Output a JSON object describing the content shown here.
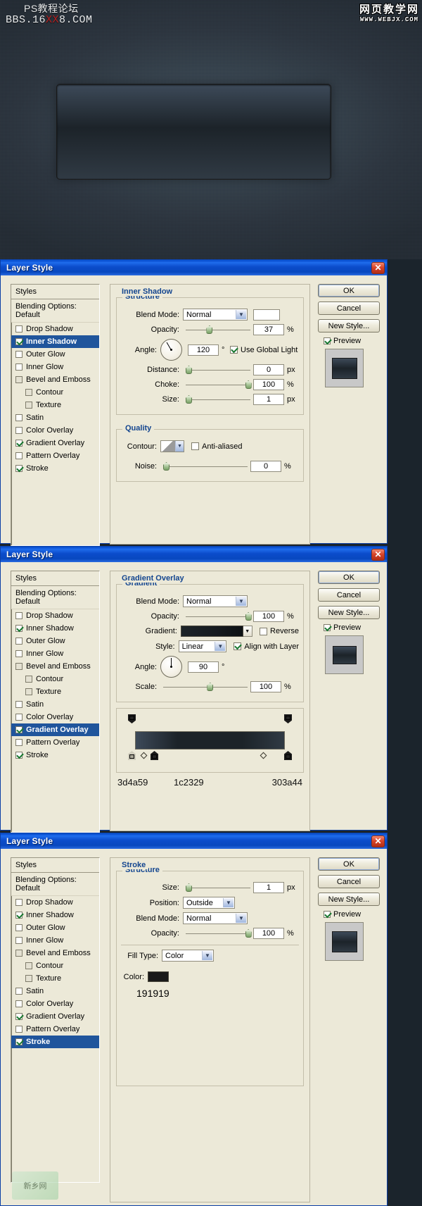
{
  "canvas": {
    "watermark_left_line1": "PS教程论坛",
    "watermark_left_line2_a": "BBS.16",
    "watermark_left_line2_hl": "XX",
    "watermark_left_line2_b": "8.COM",
    "watermark_right_line1": "网页教学网",
    "watermark_right_line2": "WWW.WEBJX.COM"
  },
  "styles_list": {
    "header": "Styles",
    "blending_options": "Blending Options: Default",
    "items": [
      {
        "label": "Drop Shadow",
        "checked": false,
        "indent": false
      },
      {
        "label": "Inner Shadow",
        "checked": true,
        "indent": false
      },
      {
        "label": "Outer Glow",
        "checked": false,
        "indent": false
      },
      {
        "label": "Inner Glow",
        "checked": false,
        "indent": false
      },
      {
        "label": "Bevel and Emboss",
        "checked": false,
        "indent": false
      },
      {
        "label": "Contour",
        "checked": false,
        "indent": true
      },
      {
        "label": "Texture",
        "checked": false,
        "indent": true
      },
      {
        "label": "Satin",
        "checked": false,
        "indent": false
      },
      {
        "label": "Color Overlay",
        "checked": false,
        "indent": false
      },
      {
        "label": "Gradient Overlay",
        "checked": true,
        "indent": false
      },
      {
        "label": "Pattern Overlay",
        "checked": false,
        "indent": false
      },
      {
        "label": "Stroke",
        "checked": true,
        "indent": false
      }
    ]
  },
  "buttons": {
    "ok": "OK",
    "cancel": "Cancel",
    "new_style": "New Style...",
    "preview": "Preview"
  },
  "dialog1": {
    "title": "Layer Style",
    "selected_effect": "Inner Shadow",
    "section_title": "Inner Shadow",
    "structure_label": "Structure",
    "quality_label": "Quality",
    "blend_mode_label": "Blend Mode:",
    "blend_mode_value": "Normal",
    "opacity_label": "Opacity:",
    "opacity_value": "37",
    "opacity_unit": "%",
    "angle_label": "Angle:",
    "angle_value": "120",
    "angle_unit": "°",
    "use_global_light": "Use Global Light",
    "use_global_light_checked": true,
    "distance_label": "Distance:",
    "distance_value": "0",
    "distance_unit": "px",
    "choke_label": "Choke:",
    "choke_value": "100",
    "choke_unit": "%",
    "size_label": "Size:",
    "size_value": "1",
    "size_unit": "px",
    "contour_label": "Contour:",
    "anti_aliased": "Anti-aliased",
    "anti_aliased_checked": false,
    "noise_label": "Noise:",
    "noise_value": "0",
    "noise_unit": "%"
  },
  "dialog2": {
    "title": "Layer Style",
    "selected_effect": "Gradient Overlay",
    "section_title": "Gradient Overlay",
    "gradient_group_label": "Gradient",
    "blend_mode_label": "Blend Mode:",
    "blend_mode_value": "Normal",
    "opacity_label": "Opacity:",
    "opacity_value": "100",
    "opacity_unit": "%",
    "gradient_label": "Gradient:",
    "reverse_label": "Reverse",
    "reverse_checked": false,
    "style_label": "Style:",
    "style_value": "Linear",
    "align_with_layer": "Align with Layer",
    "align_checked": true,
    "angle_label": "Angle:",
    "angle_value": "90",
    "angle_unit": "°",
    "scale_label": "Scale:",
    "scale_value": "100",
    "scale_unit": "%",
    "gradient_stops": [
      {
        "hex": "3d4a59",
        "position": 0
      },
      {
        "hex": "1c2329",
        "position": 14
      },
      {
        "hex": "303a44",
        "position": 100
      }
    ]
  },
  "dialog3": {
    "title": "Layer Style",
    "selected_effect": "Stroke",
    "section_title": "Stroke",
    "structure_label": "Structure",
    "size_label": "Size:",
    "size_value": "1",
    "size_unit": "px",
    "position_label": "Position:",
    "position_value": "Outside",
    "blend_mode_label": "Blend Mode:",
    "blend_mode_value": "Normal",
    "opacity_label": "Opacity:",
    "opacity_value": "100",
    "opacity_unit": "%",
    "fill_type_label": "Fill Type:",
    "fill_type_value": "Color",
    "color_label": "Color:",
    "color_hex": "191919"
  },
  "colors": {
    "titlebar_blue": "#0b4ccb",
    "dialog_bg": "#ece9d8",
    "selection_blue": "#20559c",
    "group_label_blue": "#13458f",
    "stroke_color": "#191919",
    "gradient_top": "#3d4a59",
    "gradient_mid": "#1c2329",
    "gradient_bottom": "#303a44"
  },
  "watermark_bottom": "新乡网"
}
